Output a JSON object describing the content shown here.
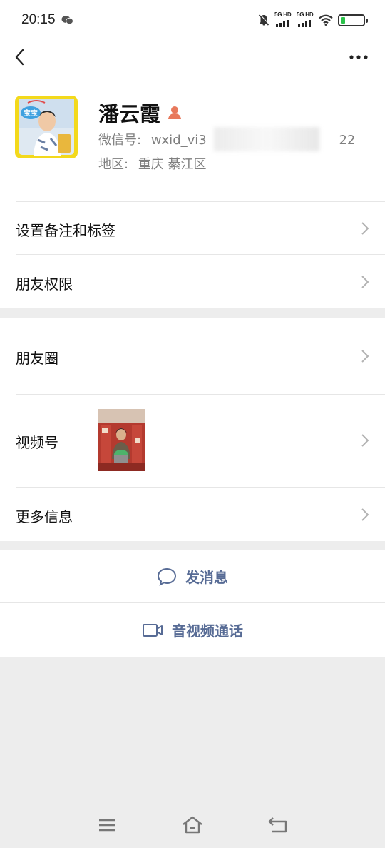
{
  "status_bar": {
    "time": "20:15",
    "network_1": "5G HD",
    "network_2": "5G HD",
    "battery_level": 0.2,
    "battery_color": "#2bc24a"
  },
  "nav": {
    "back_icon": "chevron-left-icon",
    "more_icon": "more-horizontal-icon"
  },
  "profile": {
    "name": "潘云霞",
    "wechat_id_label": "微信号:",
    "wechat_id": "wxid_vi3",
    "wechat_id_tail": "22",
    "region_label": "地区:",
    "region": "重庆 綦江区",
    "gender_icon_color": "#e8795c"
  },
  "menu_group_1": {
    "items": [
      {
        "label": "设置备注和标签"
      },
      {
        "label": "朋友权限"
      }
    ]
  },
  "menu_group_2": {
    "items": [
      {
        "label": "朋友圈"
      },
      {
        "label": "视频号"
      },
      {
        "label": "更多信息"
      }
    ]
  },
  "actions": {
    "message": "发消息",
    "call": "音视频通话",
    "accent_color": "#576b95"
  },
  "system_nav": {
    "menu_icon": "menu-icon",
    "home_icon": "home-icon",
    "back_icon": "return-icon"
  }
}
